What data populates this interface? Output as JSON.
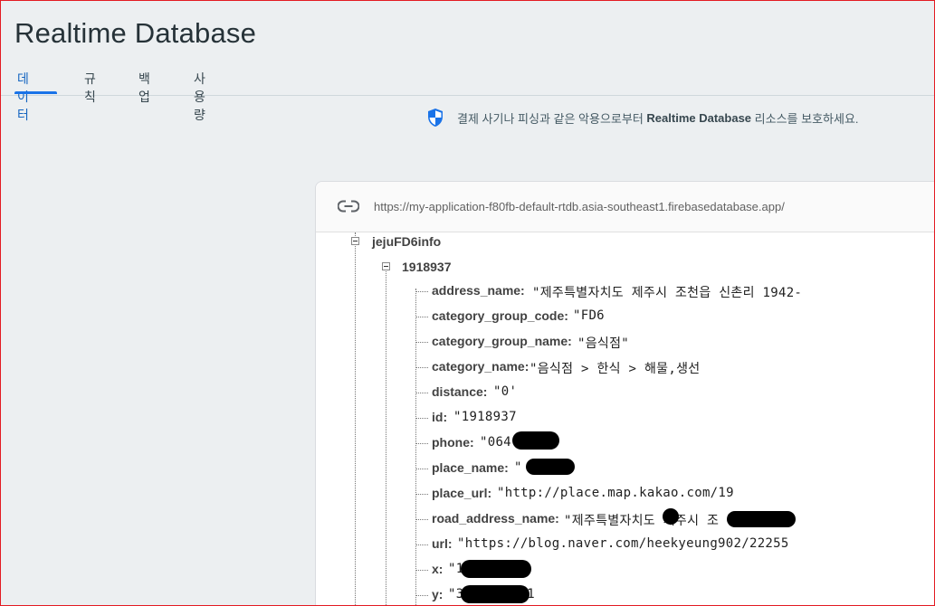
{
  "page": {
    "title": "Realtime Database"
  },
  "tabs": [
    {
      "label": "데이터",
      "active": true
    },
    {
      "label": "규칙",
      "active": false
    },
    {
      "label": "백업",
      "active": false
    },
    {
      "label": "사용량",
      "active": false
    }
  ],
  "notice": {
    "before": "결제 사기나 피싱과 같은 악용으로부터 ",
    "strong": "Realtime Database",
    "after": " 리소스를 보호하세요."
  },
  "database": {
    "url": "https://my-application-f80fb-default-rtdb.asia-southeast1.firebasedatabase.app/",
    "root_key": "jejuFD6info",
    "child_key": "1918937",
    "fields": [
      {
        "key": "address_name:",
        "value": "\"제주특별자치도 제주시 조천읍 신촌리 1942-"
      },
      {
        "key": "category_group_code:",
        "value": "\"FD6"
      },
      {
        "key": "category_group_name:",
        "value": "\"음식점\""
      },
      {
        "key": "category_name:",
        "value": "\"음식점 > 한식 > 해물,생선"
      },
      {
        "key": "distance:",
        "value": "\"0'"
      },
      {
        "key": "id:",
        "value": "\"1918937"
      },
      {
        "key": "phone:",
        "value": "\"064-"
      },
      {
        "key": "place_name:",
        "value": "\""
      },
      {
        "key": "place_url:",
        "value": "\"http://place.map.kakao.com/19"
      },
      {
        "key": "road_address_name:",
        "value": "\"제주특별자치도 제주시 조                길 40-"
      },
      {
        "key": "url:",
        "value": "\"https://blog.naver.com/heekyeung902/22255"
      },
      {
        "key": "x:",
        "value": "\"1        968644"
      },
      {
        "key": "y:",
        "value": "\"3        41059981"
      }
    ]
  },
  "colors": {
    "accent": "#1a73e8",
    "shield": "#1a73e8",
    "border": "#e31b23"
  }
}
